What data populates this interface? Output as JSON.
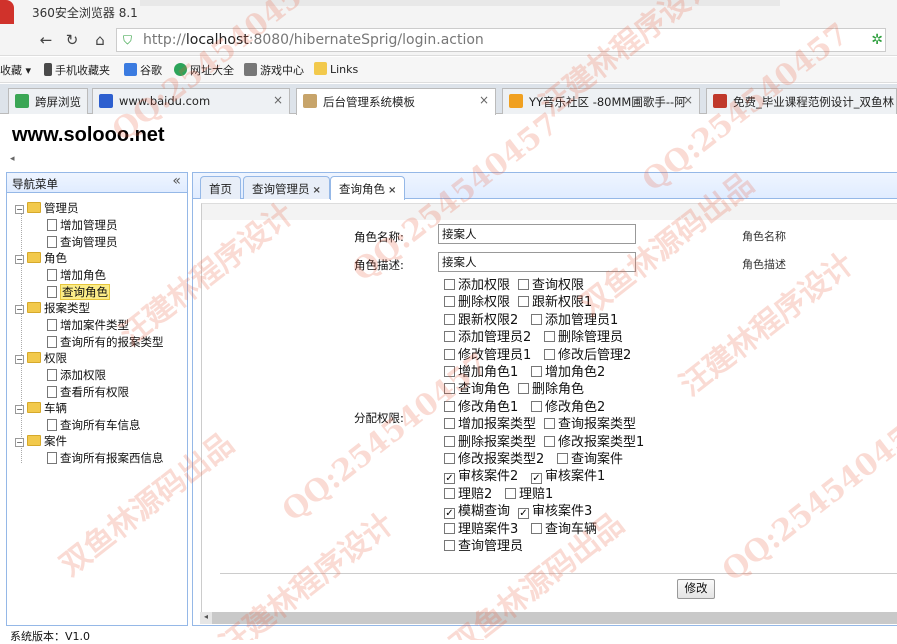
{
  "browser": {
    "app_title": "360安全浏览器 8.1",
    "url_host": "localhost",
    "url_prefix": "http://",
    "url_rest": ":8080/hibernateSprig/login.action",
    "bookmarks": [
      "收藏",
      "手机收藏夹",
      "谷歌",
      "网址大全",
      "游戏中心",
      "Links"
    ],
    "tabs": [
      {
        "label": "跨屏浏览",
        "active": false,
        "closable": false
      },
      {
        "label": "www.baidu.com",
        "active": false,
        "closable": true
      },
      {
        "label": "后台管理系统模板",
        "active": true,
        "closable": true
      },
      {
        "label": "YY音乐社区 -80MM圃歌手--阿",
        "active": false,
        "closable": true
      },
      {
        "label": "免费_毕业课程范例设计_双鱼林",
        "active": false,
        "closable": true
      }
    ],
    "close_glyph": "×"
  },
  "brand": "www.solooo.net",
  "sidebar": {
    "title": "导航菜单",
    "collapse_glyph": "«",
    "groups": [
      {
        "label": "管理员",
        "items": [
          "增加管理员",
          "查询管理员"
        ]
      },
      {
        "label": "角色",
        "items": [
          "增加角色",
          "查询角色"
        ]
      },
      {
        "label": "报案类型",
        "items": [
          "增加案件类型",
          "查询所有的报案类型"
        ]
      },
      {
        "label": "权限",
        "items": [
          "添加权限",
          "查看所有权限"
        ]
      },
      {
        "label": "车辆",
        "items": [
          "查询所有车信息"
        ]
      },
      {
        "label": "案件",
        "items": [
          "查询所有报案西信息"
        ]
      }
    ],
    "selected": "查询角色"
  },
  "main_tabs": [
    {
      "label": "首页",
      "closable": false,
      "active": false
    },
    {
      "label": "查询管理员",
      "closable": true,
      "active": false
    },
    {
      "label": "查询角色",
      "closable": true,
      "active": true
    }
  ],
  "form": {
    "name_label": "角色名称:",
    "name_value": "接案人",
    "name_hint": "角色名称",
    "desc_label": "角色描述:",
    "desc_value": "接案人",
    "desc_hint": "角色描述",
    "perm_label": "分配权限:",
    "permission_rows": [
      [
        {
          "label": "添加权限",
          "checked": false
        },
        {
          "label": "查询权限",
          "checked": false
        }
      ],
      [
        {
          "label": "删除权限",
          "checked": false
        },
        {
          "label": "跟新权限1",
          "checked": false
        }
      ],
      [
        {
          "label": "跟新权限2",
          "checked": false
        },
        {
          "label": "添加管理员1",
          "checked": false
        }
      ],
      [
        {
          "label": "添加管理员2",
          "checked": false
        },
        {
          "label": "删除管理员",
          "checked": false
        }
      ],
      [
        {
          "label": "修改管理员1",
          "checked": false
        },
        {
          "label": "修改后管理2",
          "checked": false
        }
      ],
      [
        {
          "label": "增加角色1",
          "checked": false
        },
        {
          "label": "增加角色2",
          "checked": false
        }
      ],
      [
        {
          "label": "查询角色",
          "checked": false
        },
        {
          "label": "删除角色",
          "checked": false
        }
      ],
      [
        {
          "label": "修改角色1",
          "checked": false
        },
        {
          "label": "修改角色2",
          "checked": false
        }
      ],
      [
        {
          "label": "增加报案类型",
          "checked": false
        },
        {
          "label": "查询报案类型",
          "checked": false
        }
      ],
      [
        {
          "label": "删除报案类型",
          "checked": false
        },
        {
          "label": "修改报案类型1",
          "checked": false
        }
      ],
      [
        {
          "label": "修改报案类型2",
          "checked": false
        },
        {
          "label": "查询案件",
          "checked": false
        }
      ],
      [
        {
          "label": "审核案件2",
          "checked": true
        },
        {
          "label": "审核案件1",
          "checked": true
        }
      ],
      [
        {
          "label": "理赔2",
          "checked": false
        },
        {
          "label": "理赔1",
          "checked": false
        }
      ],
      [
        {
          "label": "模糊查询",
          "checked": true
        },
        {
          "label": "审核案件3",
          "checked": true
        }
      ],
      [
        {
          "label": "理赔案件3",
          "checked": false
        },
        {
          "label": "查询车辆",
          "checked": false
        }
      ],
      [
        {
          "label": "查询管理员",
          "checked": false
        }
      ]
    ],
    "submit_label": "修改"
  },
  "footer_version": "系统版本：V1.0",
  "watermarks": [
    "QQ:254540457",
    "汪建林程序设计",
    "双鱼林源码出品"
  ]
}
